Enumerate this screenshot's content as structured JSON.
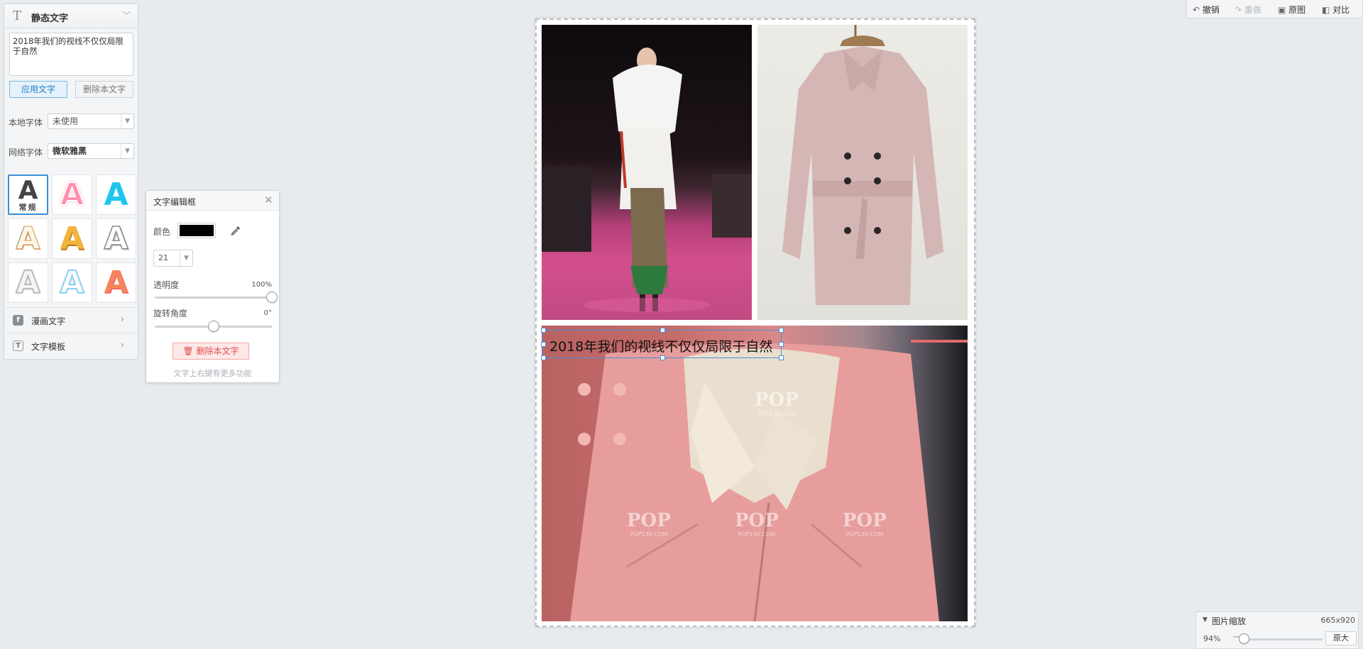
{
  "left_panel": {
    "header_title": "静态文字",
    "text_value": "2018年我们的视线不仅仅局限于自然",
    "apply_label": "应用文字",
    "delete_label": "删除本文字",
    "local_font_label": "本地字体",
    "local_font_value": "未使用",
    "web_font_label": "网络字体",
    "web_font_value": "微软雅黑",
    "style_normal_sub": "常规",
    "style_letter": "A",
    "comic_text_label": "漫画文字",
    "text_template_label": "文字模板"
  },
  "text_dialog": {
    "title": "文字编辑框",
    "color_label": "颜色",
    "color_value": "#000000",
    "size_value": "21",
    "opacity_label": "透明度",
    "opacity_value": "100%",
    "opacity_level": 1.0,
    "rotation_label": "旋转角度",
    "rotation_value": "0°",
    "rotation_level": 0.5,
    "delete_label": "删除本文字",
    "hint": "文字上右键有更多功能"
  },
  "canvas": {
    "overlay_text": "2018年我们的视线不仅仅局限于自然",
    "watermark_text": "POP",
    "watermark_sub": "POP136.COM"
  },
  "toolbar": {
    "undo_label": "撤销",
    "redo_label": "重做",
    "original_label": "原图",
    "compare_label": "对比"
  },
  "zoom_panel": {
    "title": "图片缩放",
    "dimensions": "665x920",
    "zoom_value": "94%",
    "zoom_level": 0.05,
    "original_size_label": "原大"
  },
  "colors": {
    "accent_blue": "#3a8fd6",
    "delete_red": "#e24d4d",
    "selection_blue": "#4a8fd8"
  }
}
